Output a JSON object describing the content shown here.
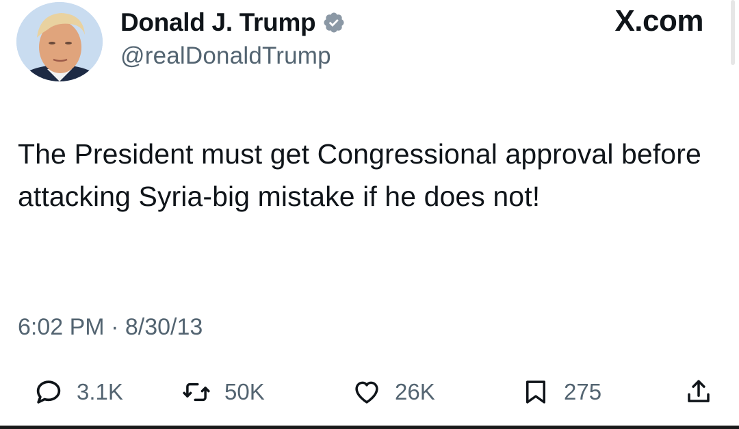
{
  "author": {
    "display_name": "Donald J. Trump",
    "handle": "@realDonaldTrump",
    "verified_icon": "verified-badge-icon",
    "avatar": "avatar-photo"
  },
  "brand": "X.com",
  "tweet": {
    "text": "The President must get Congressional approval before attacking Syria-big mistake if he does not!",
    "time": "6:02 PM",
    "separator": "·",
    "date": "8/30/13"
  },
  "actions": {
    "replies": {
      "icon": "reply-icon",
      "count": "3.1K"
    },
    "reposts": {
      "icon": "repost-icon",
      "count": "50K"
    },
    "likes": {
      "icon": "heart-icon",
      "count": "26K"
    },
    "bookmarks": {
      "icon": "bookmark-icon",
      "count": "275"
    },
    "share": {
      "icon": "share-icon"
    }
  },
  "colors": {
    "text_primary": "#0f1419",
    "text_secondary": "#536471",
    "verified_badge": "#8b98a5"
  }
}
